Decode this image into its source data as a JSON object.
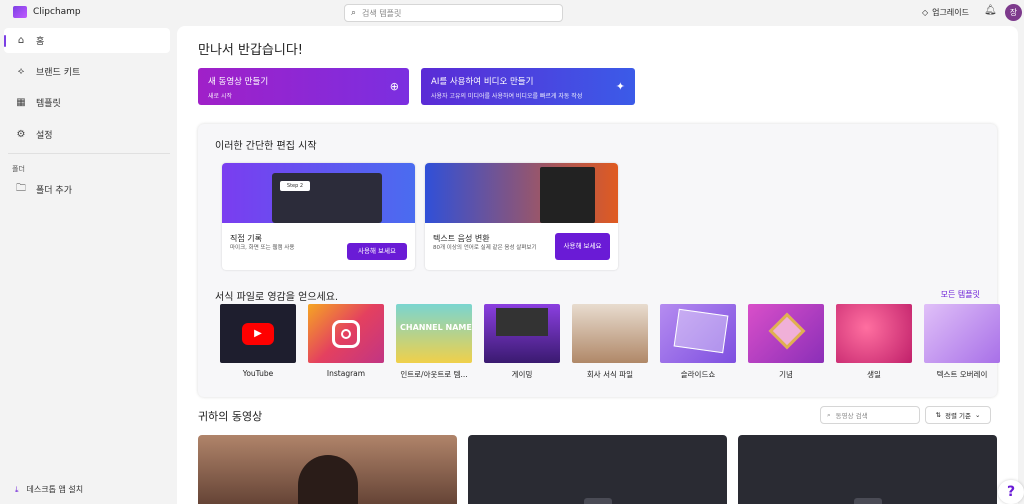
{
  "app": {
    "name": "Clipchamp"
  },
  "search": {
    "placeholder": "검색 템플릿"
  },
  "header": {
    "upgrade_label": "업그레이드",
    "avatar_initial": "장"
  },
  "sidebar": {
    "items": [
      {
        "label": "홈",
        "icon": "home-icon"
      },
      {
        "label": "브랜드 키트",
        "icon": "brand-kit-icon"
      },
      {
        "label": "템플릿",
        "icon": "templates-icon"
      },
      {
        "label": "설정",
        "icon": "gear-icon"
      }
    ],
    "folder_section": "폴더",
    "add_folder": "폴더 추가",
    "install_app": "데스크톱 앱 설치"
  },
  "main": {
    "welcome": "만나서 반갑습니다!",
    "new_video": {
      "title": "새 동영상 만들기",
      "subtitle": "새로 시작"
    },
    "ai_video": {
      "title": "AI를 사용하여 비디오 만들기",
      "subtitle": "사용자 고유의 미디어를 사용하여 비디오를 빠르게 자동 작성"
    },
    "easy_edit": {
      "title": "이러한 간단한 편집 시작",
      "cards": [
        {
          "title": "직접 기록",
          "desc": "마이크, 화면 또는 웹캠 사용",
          "button": "사용해 보세요",
          "badge": "Step 2"
        },
        {
          "title": "텍스트 음성 변환",
          "desc": "80개 이상의 언어로 실제 같은 음성 살펴보기",
          "button": "사용해 보세요"
        }
      ]
    },
    "inspiration": {
      "title": "서식 파일로 영감을 얻으세요.",
      "all_link": "모든 템플릿",
      "templates": [
        {
          "label": "YouTube"
        },
        {
          "label": "Instagram"
        },
        {
          "label": "인트로/아웃트로 템...",
          "thumb_text": "CHANNEL NAME"
        },
        {
          "label": "게이밍"
        },
        {
          "label": "회사 서식 파일"
        },
        {
          "label": "슬라이드쇼"
        },
        {
          "label": "기념"
        },
        {
          "label": "생일"
        },
        {
          "label": "텍스트 오버레이"
        }
      ]
    },
    "videos": {
      "title": "귀하의 동영상",
      "search_placeholder": "동영상 검색",
      "sort_label": "정렬 기준"
    }
  },
  "colors": {
    "accent": "#6a1bd6",
    "new_video_grad_start": "#a020c8",
    "ai_grad_start": "#5b2bd6"
  }
}
